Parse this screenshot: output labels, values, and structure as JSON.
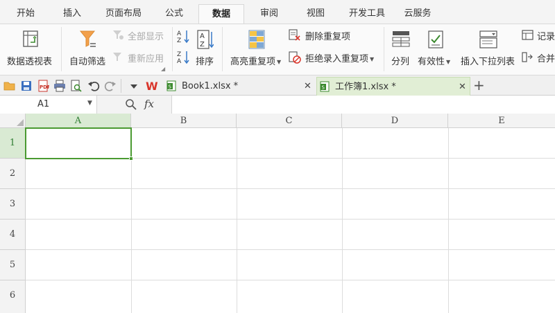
{
  "menu": {
    "tabs": [
      "开始",
      "插入",
      "页面布局",
      "公式",
      "数据",
      "审阅",
      "视图",
      "开发工具",
      "云服务"
    ],
    "active": "数据"
  },
  "ribbon": {
    "pivot": "数据透视表",
    "autofilter": "自动筛选",
    "show_all": "全部显示",
    "reapply": "重新应用",
    "sort": "排序",
    "highlight_dup": "高亮重复项",
    "delete_dup": "删除重复项",
    "reject_dup": "拒绝录入重复项",
    "split": "分列",
    "validity": "有效性",
    "dropdown": "插入下拉列表",
    "record": "记录",
    "merge": "合并"
  },
  "file_tabs": [
    {
      "name": "Book1.xlsx *",
      "active": false
    },
    {
      "name": "工作簿1.xlsx *",
      "active": true
    }
  ],
  "formula_bar": {
    "cell_ref": "A1",
    "fx": "fx",
    "value": ""
  },
  "grid": {
    "columns": [
      "A",
      "B",
      "C",
      "D",
      "E"
    ],
    "rows": [
      "1",
      "2",
      "3",
      "4",
      "5",
      "6"
    ],
    "selected_cell": "A1"
  },
  "colors": {
    "accent_green": "#4a9a31",
    "selection_header": "#d9ead3",
    "active_tab_bg": "#e1eed5",
    "wps_red": "#d9352b"
  }
}
